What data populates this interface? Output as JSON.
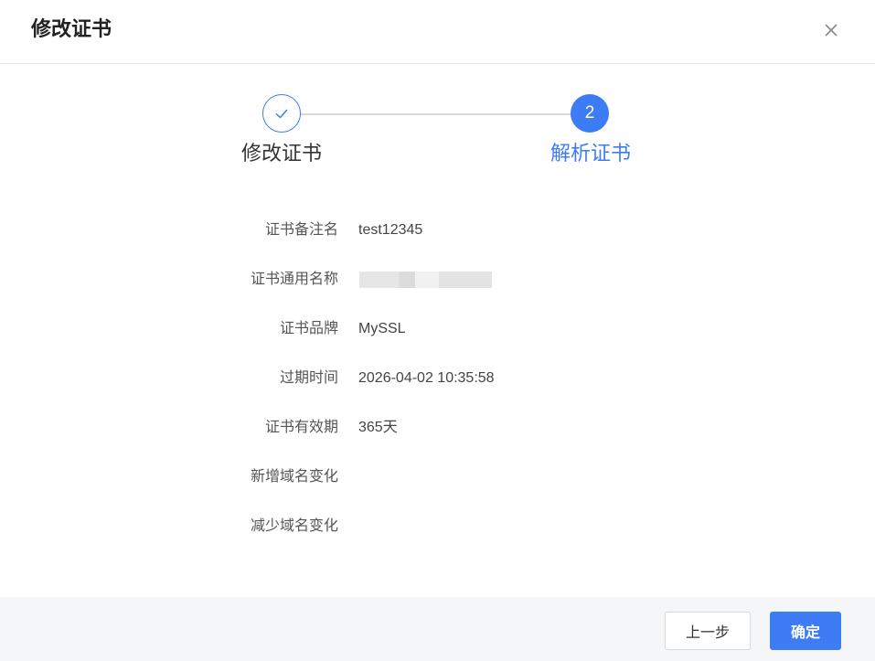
{
  "dialog": {
    "title": "修改证书",
    "close_icon": "close-icon"
  },
  "steps": [
    {
      "label": "修改证书",
      "status": "finished",
      "icon": "check-icon"
    },
    {
      "label": "解析证书",
      "status": "active",
      "number": "2"
    }
  ],
  "details": [
    {
      "label": "证书备注名",
      "value": "test12345"
    },
    {
      "label": "证书通用名称",
      "value": "",
      "masked": true
    },
    {
      "label": "证书品牌",
      "value": "MySSL"
    },
    {
      "label": "过期时间",
      "value": "2026-04-02 10:35:58"
    },
    {
      "label": "证书有效期",
      "value": "365天"
    },
    {
      "label": "新增域名变化",
      "value": ""
    },
    {
      "label": "减少域名变化",
      "value": ""
    }
  ],
  "footer": {
    "prev_label": "上一步",
    "confirm_label": "确定"
  },
  "colors": {
    "accent": "#3d7cf5",
    "footer_bg": "#f5f6f8",
    "divider": "#e8e8e8"
  }
}
